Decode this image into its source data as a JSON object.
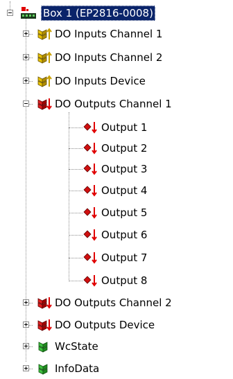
{
  "tree": {
    "root": {
      "label": "Box 1 (EP2816-0008)",
      "icon": "box-device-icon",
      "expanded": true,
      "selected": true
    },
    "inputs": [
      {
        "label": "DO Inputs Channel 1",
        "icon": "input-variable-icon",
        "expanded": false
      },
      {
        "label": "DO Inputs Channel 2",
        "icon": "input-variable-icon",
        "expanded": false
      },
      {
        "label": "DO Inputs Device",
        "icon": "input-variable-icon",
        "expanded": false
      }
    ],
    "outputs_channel_1": {
      "label": "DO Outputs Channel 1",
      "icon": "output-variable-group-icon",
      "expanded": true,
      "children": [
        {
          "label": "Output 1",
          "icon": "output-variable-icon"
        },
        {
          "label": "Output 2",
          "icon": "output-variable-icon"
        },
        {
          "label": "Output 3",
          "icon": "output-variable-icon"
        },
        {
          "label": "Output 4",
          "icon": "output-variable-icon"
        },
        {
          "label": "Output 5",
          "icon": "output-variable-icon"
        },
        {
          "label": "Output 6",
          "icon": "output-variable-icon"
        },
        {
          "label": "Output 7",
          "icon": "output-variable-icon"
        },
        {
          "label": "Output 8",
          "icon": "output-variable-icon"
        }
      ]
    },
    "tail": [
      {
        "label": "DO Outputs Channel 2",
        "icon": "output-variable-group-icon",
        "expanded": false
      },
      {
        "label": "DO Outputs Device",
        "icon": "output-variable-group-icon",
        "expanded": false
      },
      {
        "label": "WcState",
        "icon": "status-variable-icon",
        "expanded": false
      },
      {
        "label": "InfoData",
        "icon": "status-variable-icon",
        "expanded": false
      }
    ]
  },
  "colors": {
    "selection_bg": "#0a246a",
    "input_icon": "#c8a000",
    "output_icon": "#c00000",
    "status_icon": "#2aa02a"
  }
}
